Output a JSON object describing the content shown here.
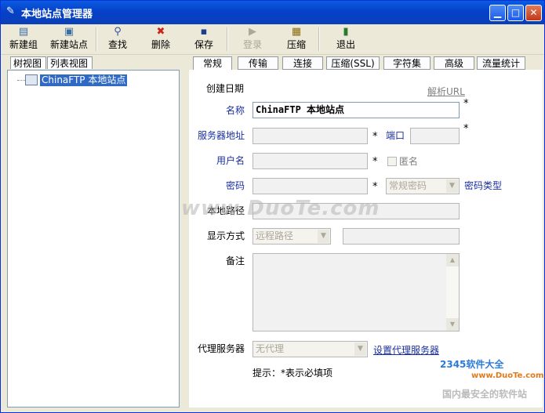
{
  "window": {
    "title": "本地站点管理器"
  },
  "toolbar": {
    "new_group": "新建组",
    "new_site": "新建站点",
    "find": "查找",
    "delete": "删除",
    "save": "保存",
    "login": "登录",
    "compress": "压缩",
    "exit": "退出"
  },
  "left_tabs": [
    "树视图",
    "列表视图"
  ],
  "tree": {
    "site_label": "ChinaFTP 本地站点"
  },
  "right_tabs": [
    "常规",
    "传输",
    "连接",
    "压缩(SSL)",
    "字符集",
    "高级",
    "流量统计"
  ],
  "form": {
    "created_date_label": "创建日期",
    "parse_url_link": "解析URL",
    "name_label": "名称",
    "name_value": "ChinaFTP 本地站点",
    "server_label": "服务器地址",
    "port_label": "端口",
    "username_label": "用户名",
    "anonymous_label": "匿名",
    "password_label": "密码",
    "password_type_value": "常规密码",
    "password_type_label": "密码类型",
    "local_path_label": "本地路径",
    "display_mode_label": "显示方式",
    "display_mode_value": "远程路径",
    "remarks_label": "备注",
    "proxy_label": "代理服务器",
    "proxy_value": "无代理",
    "set_proxy_link": "设置代理服务器",
    "hint": "提示：*表示必填项",
    "required_mark": "*"
  },
  "watermark": {
    "main": "www.DuoTe.com",
    "logo": "2345软件大全",
    "site": "www.DuoTe.com",
    "tagline": "国内最安全的软件站"
  }
}
